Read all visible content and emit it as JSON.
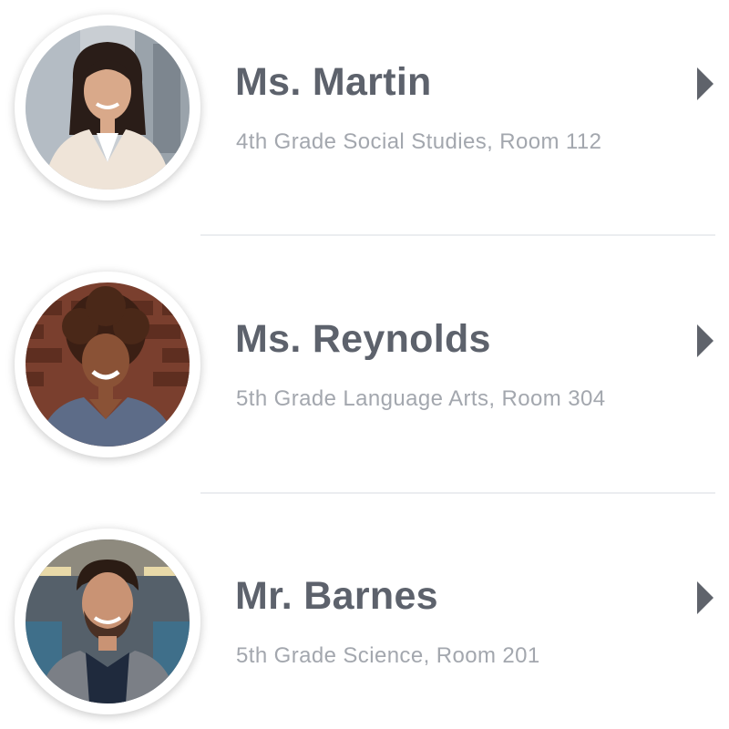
{
  "teachers": [
    {
      "name": "Ms. Martin",
      "subtitle": "4th Grade Social Studies, Room 112",
      "avatar_icon": "avatar-photo",
      "chevron_icon": "chevron-right-icon"
    },
    {
      "name": "Ms. Reynolds",
      "subtitle": "5th Grade Language Arts, Room 304",
      "avatar_icon": "avatar-photo",
      "chevron_icon": "chevron-right-icon"
    },
    {
      "name": "Mr. Barnes",
      "subtitle": "5th Grade Science, Room 201",
      "avatar_icon": "avatar-photo",
      "chevron_icon": "chevron-right-icon"
    }
  ],
  "colors": {
    "name_text": "#5d626c",
    "subtitle_text": "#a3a7ae",
    "chevron": "#5f636b",
    "divider": "#ebedf0"
  }
}
